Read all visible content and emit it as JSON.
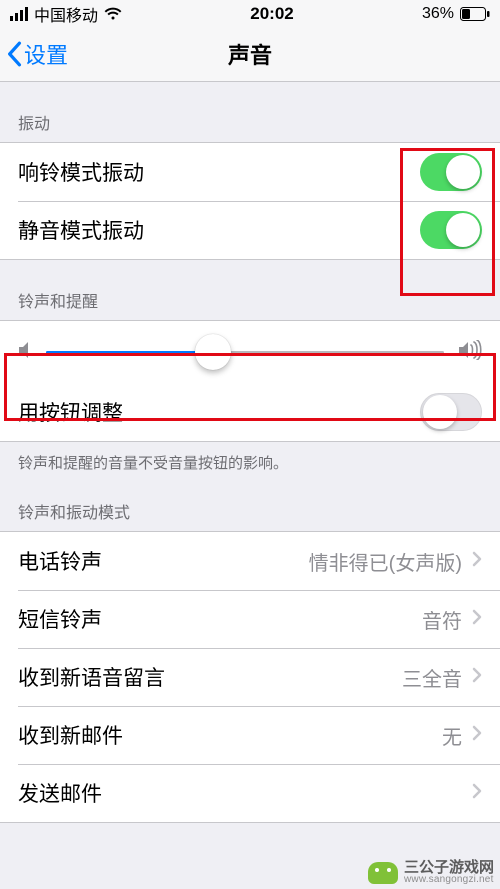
{
  "status": {
    "carrier": "中国移动",
    "time": "20:02",
    "battery_pct": "36%"
  },
  "nav": {
    "back_label": "设置",
    "title": "声音"
  },
  "sections": {
    "vibrate": {
      "header": "振动",
      "ring_vibrate_label": "响铃模式振动",
      "ring_vibrate_on": true,
      "silent_vibrate_label": "静音模式振动",
      "silent_vibrate_on": true
    },
    "ringer": {
      "header": "铃声和提醒",
      "slider_value": 0.42,
      "button_adjust_label": "用按钮调整",
      "button_adjust_on": false,
      "footer": "铃声和提醒的音量不受音量按钮的影响。"
    },
    "patterns": {
      "header": "铃声和振动模式",
      "items": [
        {
          "label": "电话铃声",
          "value": "情非得已(女声版)"
        },
        {
          "label": "短信铃声",
          "value": "音符"
        },
        {
          "label": "收到新语音留言",
          "value": "三全音"
        },
        {
          "label": "收到新邮件",
          "value": "无"
        },
        {
          "label": "发送邮件",
          "value": ""
        }
      ]
    }
  },
  "watermark": {
    "name": "三公子游戏网",
    "url": "www.sangongzi.net"
  }
}
